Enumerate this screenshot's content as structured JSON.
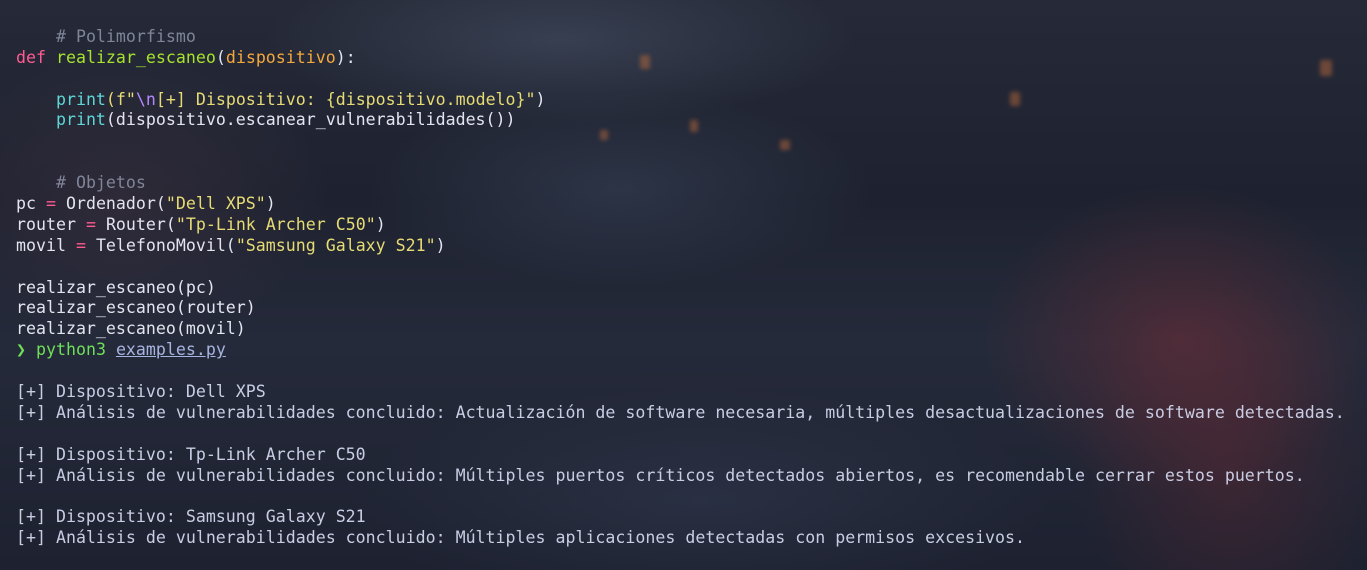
{
  "code": {
    "comment_polimorfismo": "# Polimorfismo",
    "def_kw": "def",
    "func_name": "realizar_escaneo",
    "paren_open": "(",
    "param": "dispositivo",
    "paren_close_colon": "):",
    "indent": "    ",
    "print_fn": "print",
    "print1_open": "(f\"",
    "print1_escape": "\\n",
    "print1_text": "[+] Dispositivo: {dispositivo.modelo}\"",
    "print1_close": ")",
    "print2_rest": "(dispositivo.escanear_vulnerabilidades())",
    "comment_objetos": "# Objetos",
    "obj_pc_var": "pc",
    "obj_router_var": "router",
    "obj_movil_var": "movil",
    "assign_op": " = ",
    "cls_ordenador": "Ordenador(",
    "cls_router": "Router(",
    "cls_telefono": "TelefonoMovil(",
    "str_pc": "\"Dell XPS\"",
    "str_router": "\"Tp-Link Archer C50\"",
    "str_movil": "\"Samsung Galaxy S21\"",
    "close_paren": ")",
    "call_pc": "realizar_escaneo(pc)",
    "call_router": "realizar_escaneo(router)",
    "call_movil": "realizar_escaneo(movil)"
  },
  "shell": {
    "prompt_symbol": "❯",
    "command": "python3",
    "file": "examples.py"
  },
  "output": {
    "device1": "[+] Dispositivo: Dell XPS",
    "result1": "[+] Análisis de vulnerabilidades concluido: Actualización de software necesaria, múltiples desactualizaciones de software detectadas.",
    "device2": "[+] Dispositivo: Tp-Link Archer C50",
    "result2": "[+] Análisis de vulnerabilidades concluido: Múltiples puertos críticos detectados abiertos, es recomendable cerrar estos puertos.",
    "device3": "[+] Dispositivo: Samsung Galaxy S21",
    "result3": "[+] Análisis de vulnerabilidades concluido: Múltiples aplicaciones detectadas con permisos excesivos."
  },
  "colors": {
    "comment": "#7f8598",
    "keyword": "#ff5a91",
    "function": "#a6e22e",
    "parameter": "#f4a83b",
    "builtin": "#5fd7d7",
    "string": "#e6db74",
    "prompt": "#6ee056"
  }
}
